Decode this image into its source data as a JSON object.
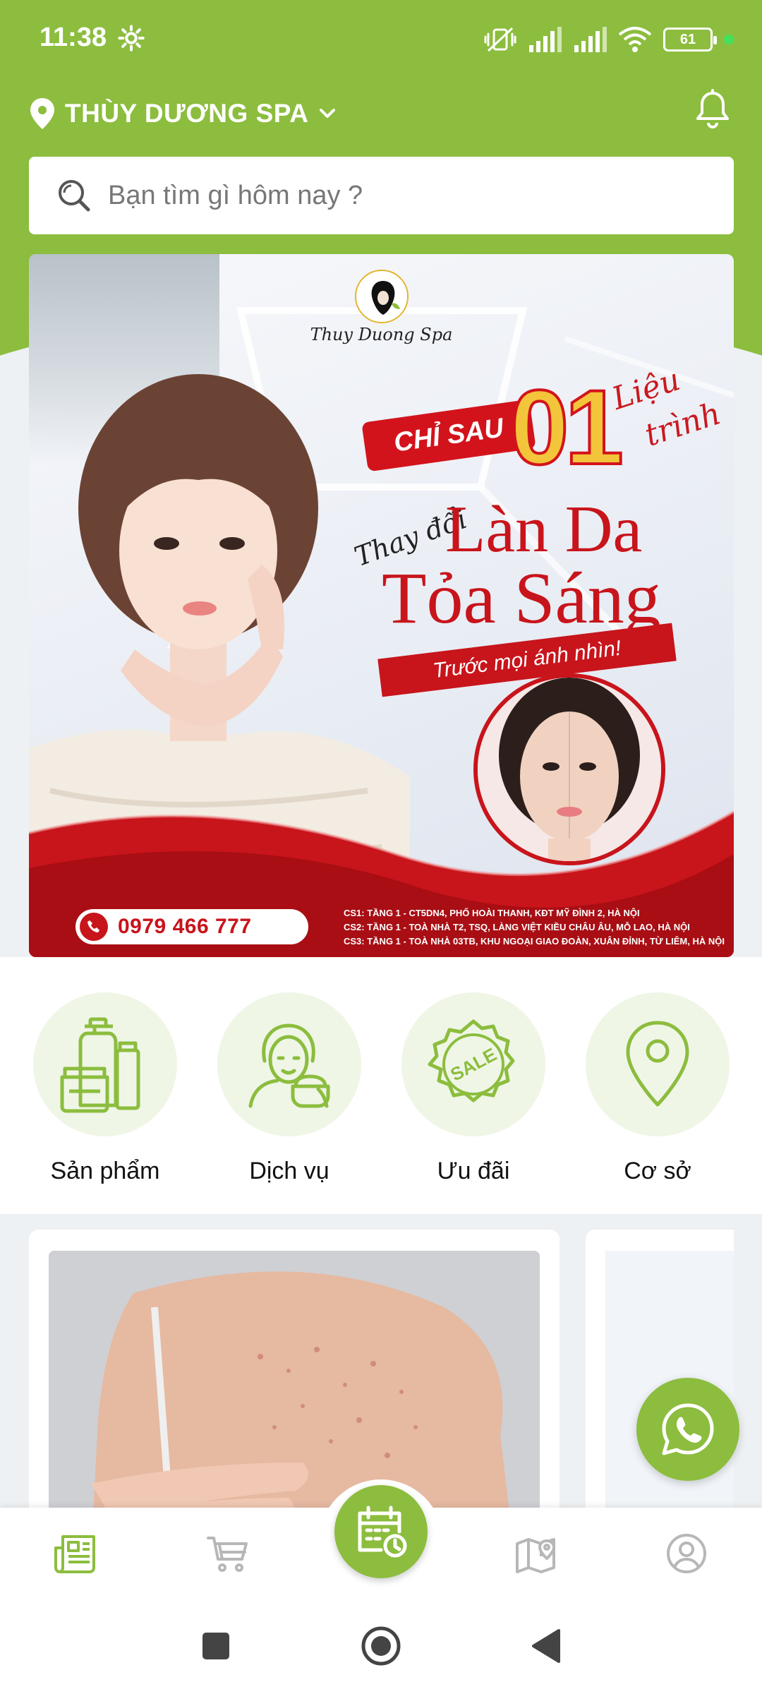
{
  "status_bar": {
    "time": "11:38",
    "battery": "61",
    "icons": [
      "gear-icon",
      "mute-vibrate-icon",
      "signal-icon",
      "signal-icon",
      "wifi-icon",
      "battery-icon"
    ]
  },
  "header": {
    "location_name": "THÙY DƯƠNG SPA",
    "icons": [
      "location-pin-icon",
      "chevron-down-icon",
      "bell-icon"
    ]
  },
  "search": {
    "placeholder": "Bạn tìm gì hôm nay ?"
  },
  "banner": {
    "brand": "Thuy Duong Spa",
    "tagline_prefix": "CHỈ SAU",
    "tagline_number": "01",
    "tagline_suffix_1": "Liệu",
    "tagline_suffix_2": "trình",
    "script_text": "Thay đổi",
    "headline_1": "Làn Da",
    "headline_2": "Tỏa Sáng",
    "ribbon_text": "Trước mọi ánh nhìn!",
    "phone": "0979 466 777",
    "addresses": [
      "CS1: TẦNG 1 - CT5DN4, PHỐ HOÀI THANH, KĐT MỸ ĐÌNH 2, HÀ NỘI",
      "CS2: TẦNG 1 - TOÀ NHÀ T2, TSQ, LÀNG VIỆT KIỀU CHÂU ÂU, MỖ LAO, HÀ NỘI",
      "CS3: TẦNG 1 - TOÀ NHÀ 03TB, KHU NGOẠI GIAO ĐOÀN, XUÂN ĐỈNH, TỪ LIÊM, HÀ NỘI"
    ]
  },
  "categories": [
    {
      "label": "Sản phẩm",
      "icon": "cosmetics-icon"
    },
    {
      "label": "Dịch vụ",
      "icon": "face-care-icon"
    },
    {
      "label": "Ưu đãi",
      "icon": "sale-badge-icon",
      "badge_text": "SALE"
    },
    {
      "label": "Cơ sở",
      "icon": "location-pin-icon"
    }
  ],
  "bottom_nav": {
    "items": [
      "news-icon",
      "cart-icon",
      "calendar-clock-icon",
      "map-icon",
      "account-icon"
    ],
    "active": "news-icon"
  },
  "colors": {
    "brand_green": "#8cbd3e",
    "banner_red": "#c8141b",
    "gold": "#f3c53a"
  }
}
